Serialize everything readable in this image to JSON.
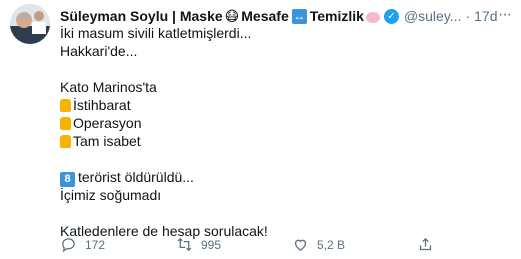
{
  "tweet": {
    "author_name": "Süleyman Soylu | Maske",
    "name_part_mask_emoji": "😷",
    "name_part_mesafe": "Mesafe",
    "name_part_temizlik": "Temizlik",
    "handle": "@suley...",
    "separator": "·",
    "time": "17d",
    "lines": {
      "l1": "İki masum sivili katletmişlerdi...",
      "l2": "Hakkari'de...",
      "l3": "Kato Marinos'ta",
      "l4": "İstihbarat",
      "l5": "Operasyon",
      "l6": "Tam isabet",
      "l7_badge": "8",
      "l7": "terörist öldürüldü...",
      "l8": "İçimiz soğumadı",
      "l9": "Katledenlere de hesap sorulacak!"
    },
    "actions": {
      "replies": "172",
      "retweets": "995",
      "likes": "5,2 B"
    }
  },
  "icons": [
    "avatar",
    "mask-emoji",
    "left-right-arrow-icon",
    "soap-emoji",
    "verified-icon",
    "more-icon",
    "thumbs-up-icon",
    "keycap-8-icon",
    "reply-icon",
    "retweet-icon",
    "like-icon",
    "share-icon"
  ],
  "colors": {
    "verified": "#1da1f2",
    "muted": "#5b7083",
    "text": "#0f1419"
  }
}
